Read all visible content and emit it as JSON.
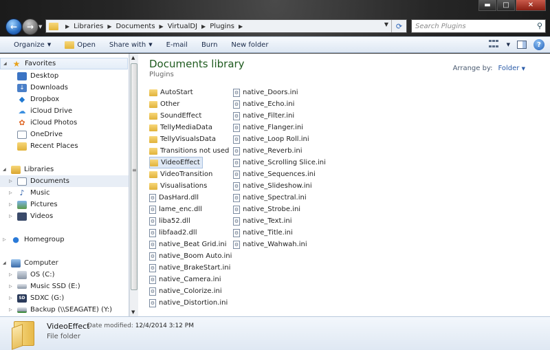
{
  "window": {
    "minimize": "▬",
    "maximize": "□",
    "close": "✕"
  },
  "address": {
    "crumbs": [
      "Libraries",
      "Documents",
      "VirtualDJ",
      "Plugins"
    ]
  },
  "search": {
    "placeholder": "Search Plugins"
  },
  "toolbar": {
    "organize": "Organize",
    "open": "Open",
    "share_with": "Share with",
    "email": "E-mail",
    "burn": "Burn",
    "new_folder": "New folder"
  },
  "nav": {
    "favorites": {
      "label": "Favorites",
      "items": [
        "Desktop",
        "Downloads",
        "Dropbox",
        "iCloud Drive",
        "iCloud Photos",
        "OneDrive",
        "Recent Places"
      ]
    },
    "libraries": {
      "label": "Libraries",
      "items": [
        "Documents",
        "Music",
        "Pictures",
        "Videos"
      ]
    },
    "homegroup": "Homegroup",
    "computer": {
      "label": "Computer",
      "items": [
        "OS (C:)",
        "Music SSD (E:)",
        "SDXC (G:)",
        "Backup (\\\\SEAGATE) (Y:)"
      ]
    }
  },
  "content": {
    "title": "Documents library",
    "subtitle": "Plugins",
    "arrange_label": "Arrange by:",
    "arrange_value": "Folder",
    "col1": [
      {
        "name": "AutoStart",
        "kind": "folder"
      },
      {
        "name": "Other",
        "kind": "folder"
      },
      {
        "name": "SoundEffect",
        "kind": "folder"
      },
      {
        "name": "TellyMediaData",
        "kind": "folder"
      },
      {
        "name": "TellyVisualsData",
        "kind": "folder"
      },
      {
        "name": "Transitions not used",
        "kind": "folder"
      },
      {
        "name": "VideoEffect",
        "kind": "folder",
        "selected": true
      },
      {
        "name": "VideoTransition",
        "kind": "folder"
      },
      {
        "name": "Visualisations",
        "kind": "folder"
      },
      {
        "name": "DasHard.dll",
        "kind": "file"
      },
      {
        "name": "lame_enc.dll",
        "kind": "file"
      },
      {
        "name": "liba52.dll",
        "kind": "file"
      },
      {
        "name": "libfaad2.dll",
        "kind": "file"
      },
      {
        "name": "native_Beat Grid.ini",
        "kind": "file"
      },
      {
        "name": "native_Boom Auto.ini",
        "kind": "file"
      },
      {
        "name": "native_BrakeStart.ini",
        "kind": "file"
      },
      {
        "name": "native_Camera.ini",
        "kind": "file"
      },
      {
        "name": "native_Colorize.ini",
        "kind": "file"
      },
      {
        "name": "native_Distortion.ini",
        "kind": "file"
      }
    ],
    "col2": [
      {
        "name": "native_Doors.ini",
        "kind": "file"
      },
      {
        "name": "native_Echo.ini",
        "kind": "file"
      },
      {
        "name": "native_Filter.ini",
        "kind": "file"
      },
      {
        "name": "native_Flanger.ini",
        "kind": "file"
      },
      {
        "name": "native_Loop Roll.ini",
        "kind": "file"
      },
      {
        "name": "native_Reverb.ini",
        "kind": "file"
      },
      {
        "name": "native_Scrolling Slice.ini",
        "kind": "file"
      },
      {
        "name": "native_Sequences.ini",
        "kind": "file"
      },
      {
        "name": "native_Slideshow.ini",
        "kind": "file"
      },
      {
        "name": "native_Spectral.ini",
        "kind": "file"
      },
      {
        "name": "native_Strobe.ini",
        "kind": "file"
      },
      {
        "name": "native_Text.ini",
        "kind": "file"
      },
      {
        "name": "native_Title.ini",
        "kind": "file"
      },
      {
        "name": "native_Wahwah.ini",
        "kind": "file"
      }
    ]
  },
  "status": {
    "name": "VideoEffect",
    "modified_label": "Date modified:",
    "modified_value": "12/4/2014 3:12 PM",
    "type": "File folder"
  }
}
